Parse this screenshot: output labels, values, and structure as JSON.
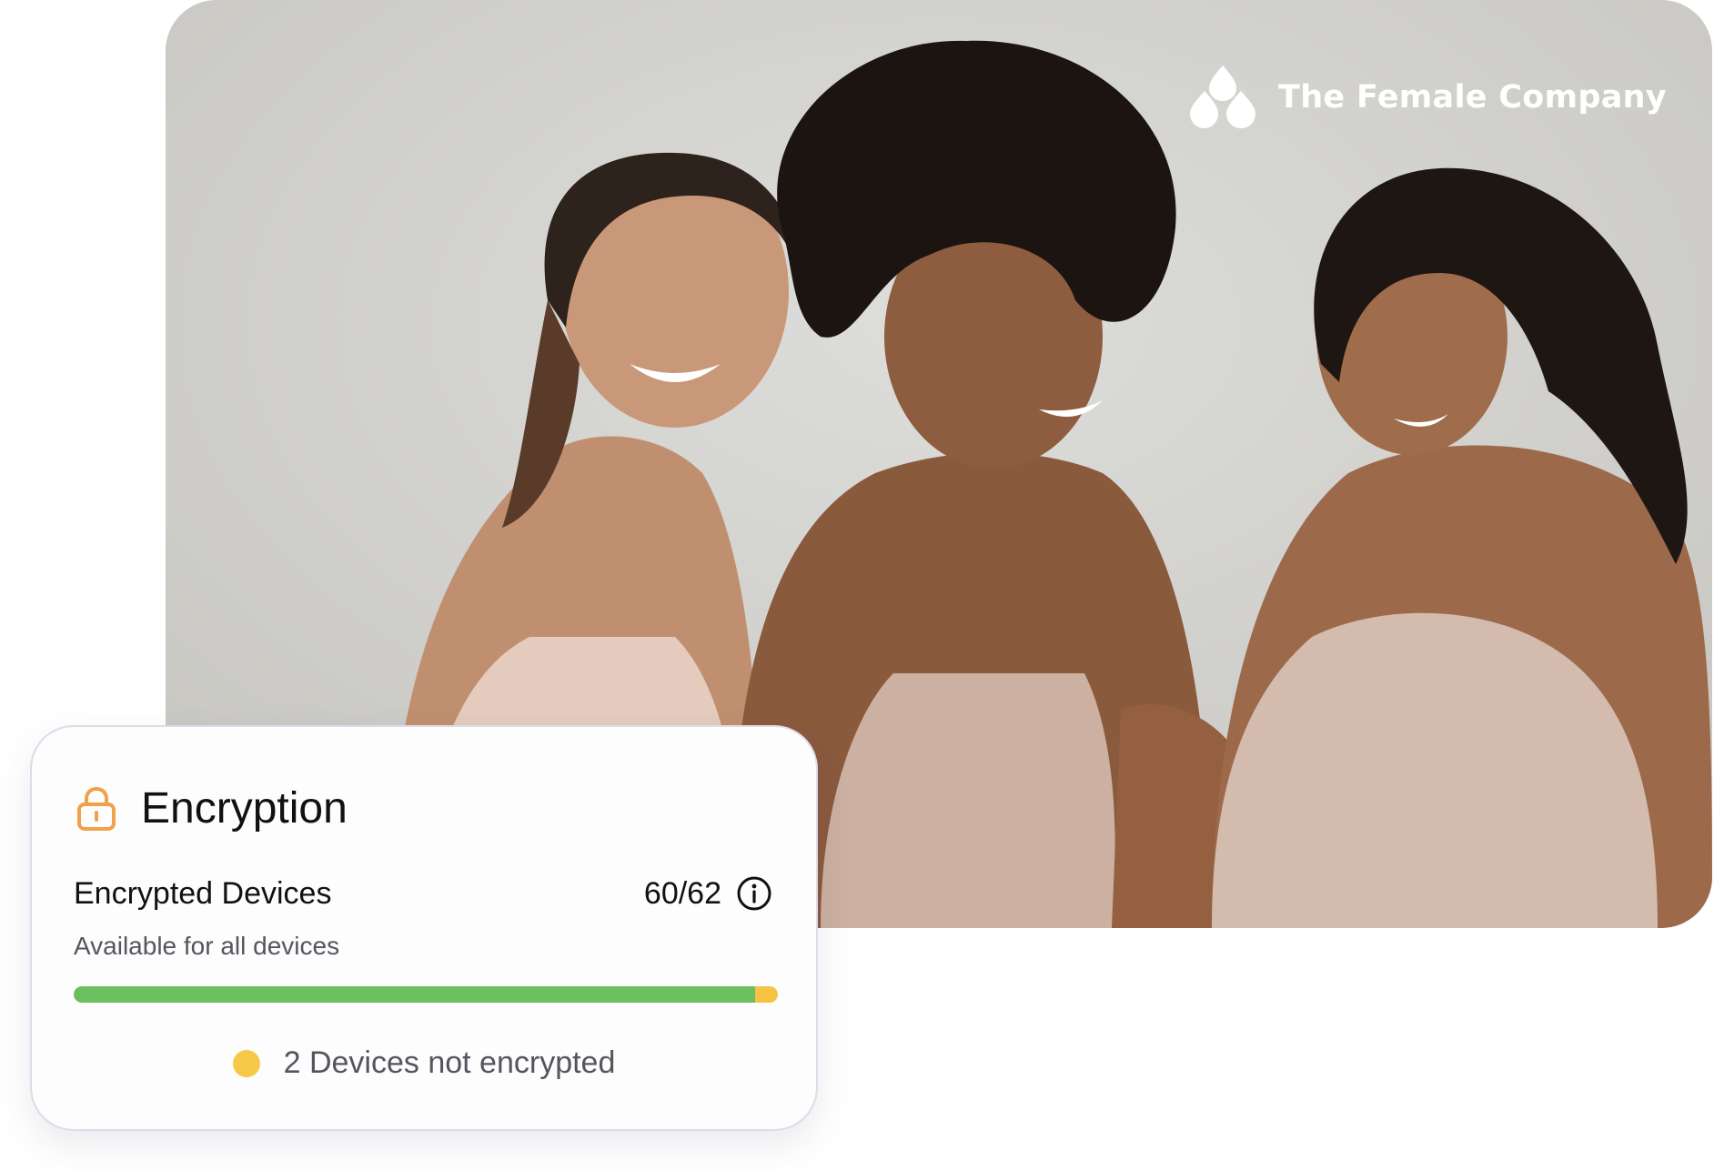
{
  "brand": {
    "name": "The Female Company",
    "logo_icon": "droplets-icon"
  },
  "photo": {
    "subject_icon": "photo-three-women"
  },
  "card": {
    "title": "Encryption",
    "title_icon": "lock-icon",
    "row_label": "Encrypted Devices",
    "count": "60/62",
    "encrypted_fraction": 0.968,
    "info_icon": "info-icon",
    "subtext": "Available for all devices",
    "status_text": "2 Devices not encrypted",
    "status_icon": "status-dot-icon"
  },
  "colors": {
    "accent_lock": "#f0a24a",
    "progress_good": "#6cbf5f",
    "progress_warn": "#f6c343",
    "status_dot": "#f7c948"
  }
}
